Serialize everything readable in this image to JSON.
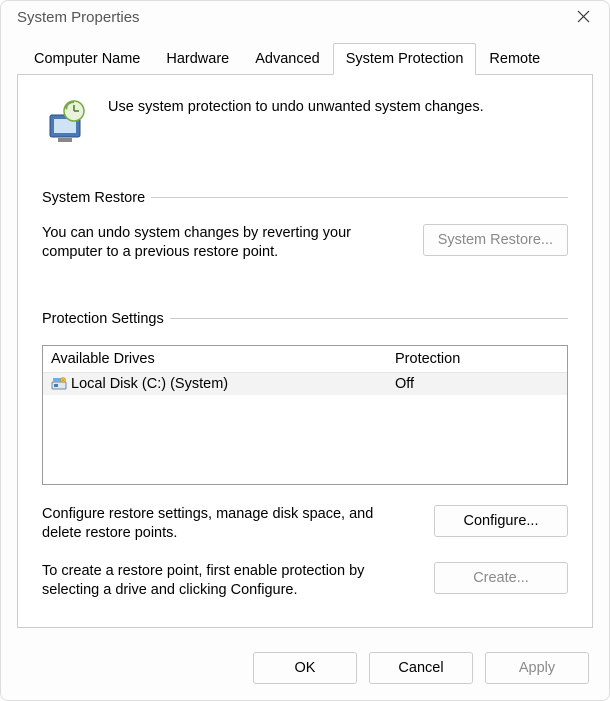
{
  "window": {
    "title": "System Properties"
  },
  "tabs": [
    {
      "label": "Computer Name"
    },
    {
      "label": "Hardware"
    },
    {
      "label": "Advanced"
    },
    {
      "label": "System Protection",
      "active": true
    },
    {
      "label": "Remote"
    }
  ],
  "intro": "Use system protection to undo unwanted system changes.",
  "restore": {
    "title": "System Restore",
    "desc": "You can undo system changes by reverting your computer to a previous restore point.",
    "button": "System Restore..."
  },
  "settings": {
    "title": "Protection Settings",
    "columns": {
      "drive": "Available Drives",
      "protection": "Protection"
    },
    "rows": [
      {
        "name": "Local Disk (C:) (System)",
        "protection": "Off"
      }
    ],
    "configure": {
      "desc": "Configure restore settings, manage disk space, and delete restore points.",
      "button": "Configure..."
    },
    "create": {
      "desc": "To create a restore point, first enable protection by selecting a drive and clicking Configure.",
      "button": "Create..."
    }
  },
  "footer": {
    "ok": "OK",
    "cancel": "Cancel",
    "apply": "Apply"
  }
}
